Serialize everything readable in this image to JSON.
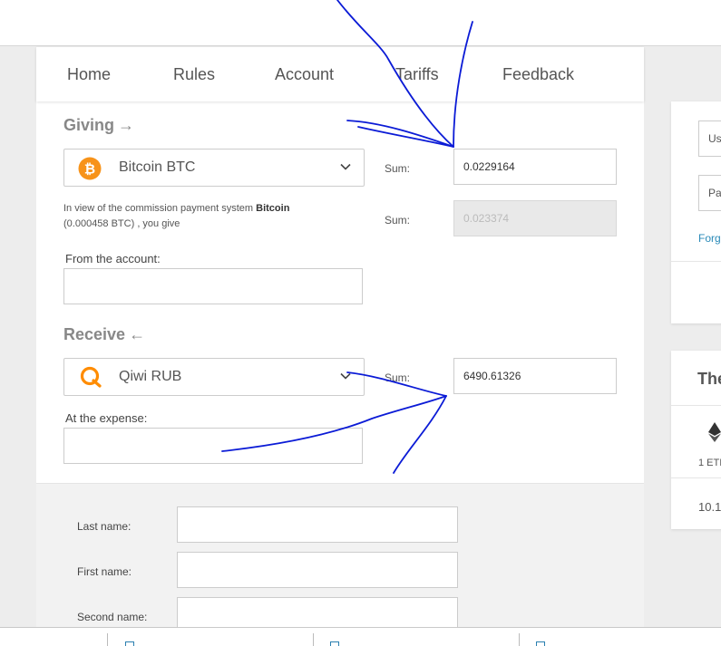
{
  "nav": {
    "items": [
      "Home",
      "Rules",
      "Account",
      "Tariffs",
      "Feedback"
    ]
  },
  "giving": {
    "title": "Giving",
    "arrow": "→",
    "currency": "Bitcoin BTC",
    "currency_icon": "bitcoin-icon",
    "sum_label": "Sum:",
    "sum_value": "0.0229164",
    "commission_prefix": "In view of the commission payment system ",
    "commission_system": "Bitcoin",
    "commission_suffix": "(0.000458 BTC) , you give",
    "commission_sum_label": "Sum:",
    "commission_sum_value": "0.023374",
    "account_label": "From the account:"
  },
  "receive": {
    "title": "Receive",
    "arrow": "←",
    "currency": "Qiwi RUB",
    "currency_icon": "qiwi-icon",
    "sum_label": "Sum:",
    "sum_value": "6490.61326",
    "expense_label": "At the expense:"
  },
  "personal": {
    "last_name_label": "Last name:",
    "first_name_label": "First name:",
    "second_name_label": "Second name:"
  },
  "sidebar": {
    "username_placeholder": "Us",
    "password_placeholder": "Pa",
    "forgot_link": "Forg",
    "rates_title": "The",
    "rate_unit": "1 ETI",
    "rate_value": "10.1"
  },
  "colors": {
    "bitcoin_orange": "#f7931a",
    "qiwi_orange": "#ff8c00",
    "link_blue": "#2a8ab8",
    "annotation_ink": "#0b1bd6"
  }
}
